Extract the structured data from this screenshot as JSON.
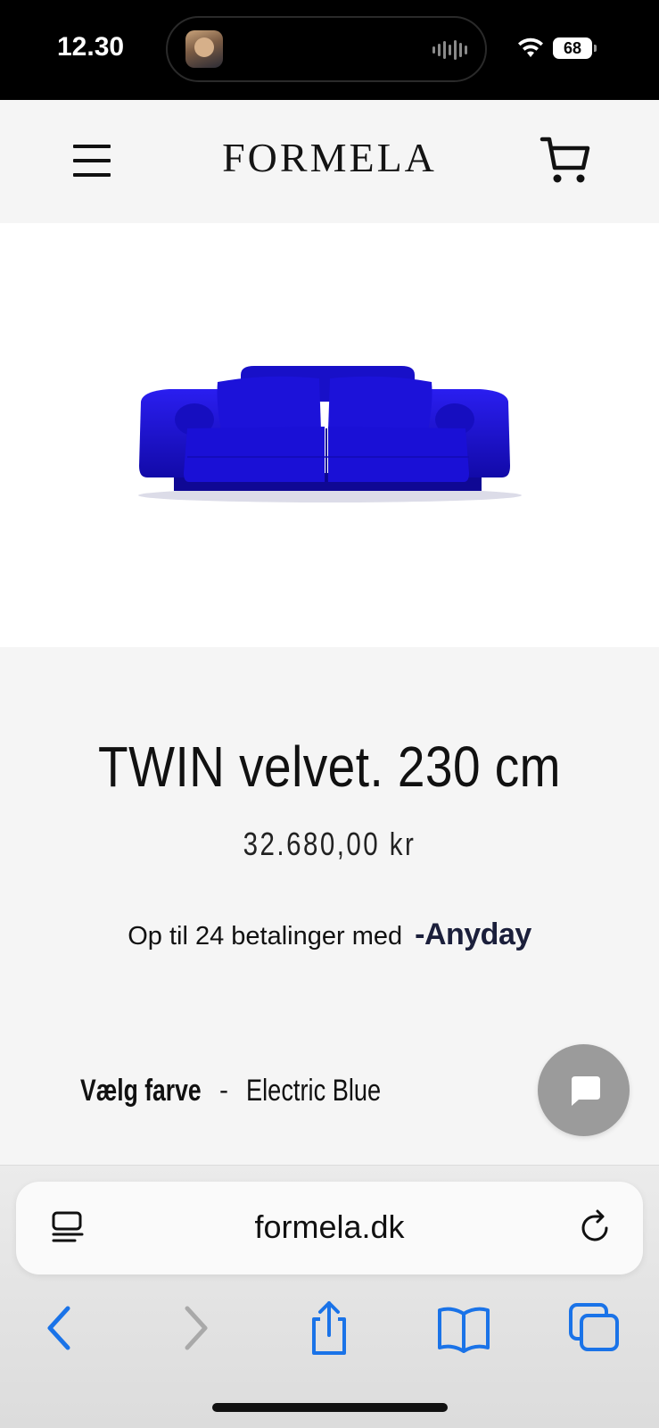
{
  "status_bar": {
    "time": "12.30",
    "battery": "68"
  },
  "header": {
    "logo": "FORMELA"
  },
  "product": {
    "title": "TWIN velvet. 230 cm",
    "price": "32.680,00 kr",
    "installments_text": "Op til 24 betalinger med",
    "installments_brand": "Anyday",
    "color_label": "Vælg farve",
    "color_separator": "-",
    "color_value": "Electric Blue",
    "sofa_color": "#1a10d6"
  },
  "browser": {
    "url": "formela.dk"
  },
  "colors": {
    "page_bg": "#f5f5f5",
    "accent_ios": "#1a73e8",
    "chat_button": "#9b9b9b"
  },
  "icons": [
    "hamburger-menu-icon",
    "cart-icon",
    "chat-icon",
    "reader-icon",
    "reload-icon",
    "back-icon",
    "forward-icon",
    "share-icon",
    "bookmarks-icon",
    "tabs-icon"
  ]
}
